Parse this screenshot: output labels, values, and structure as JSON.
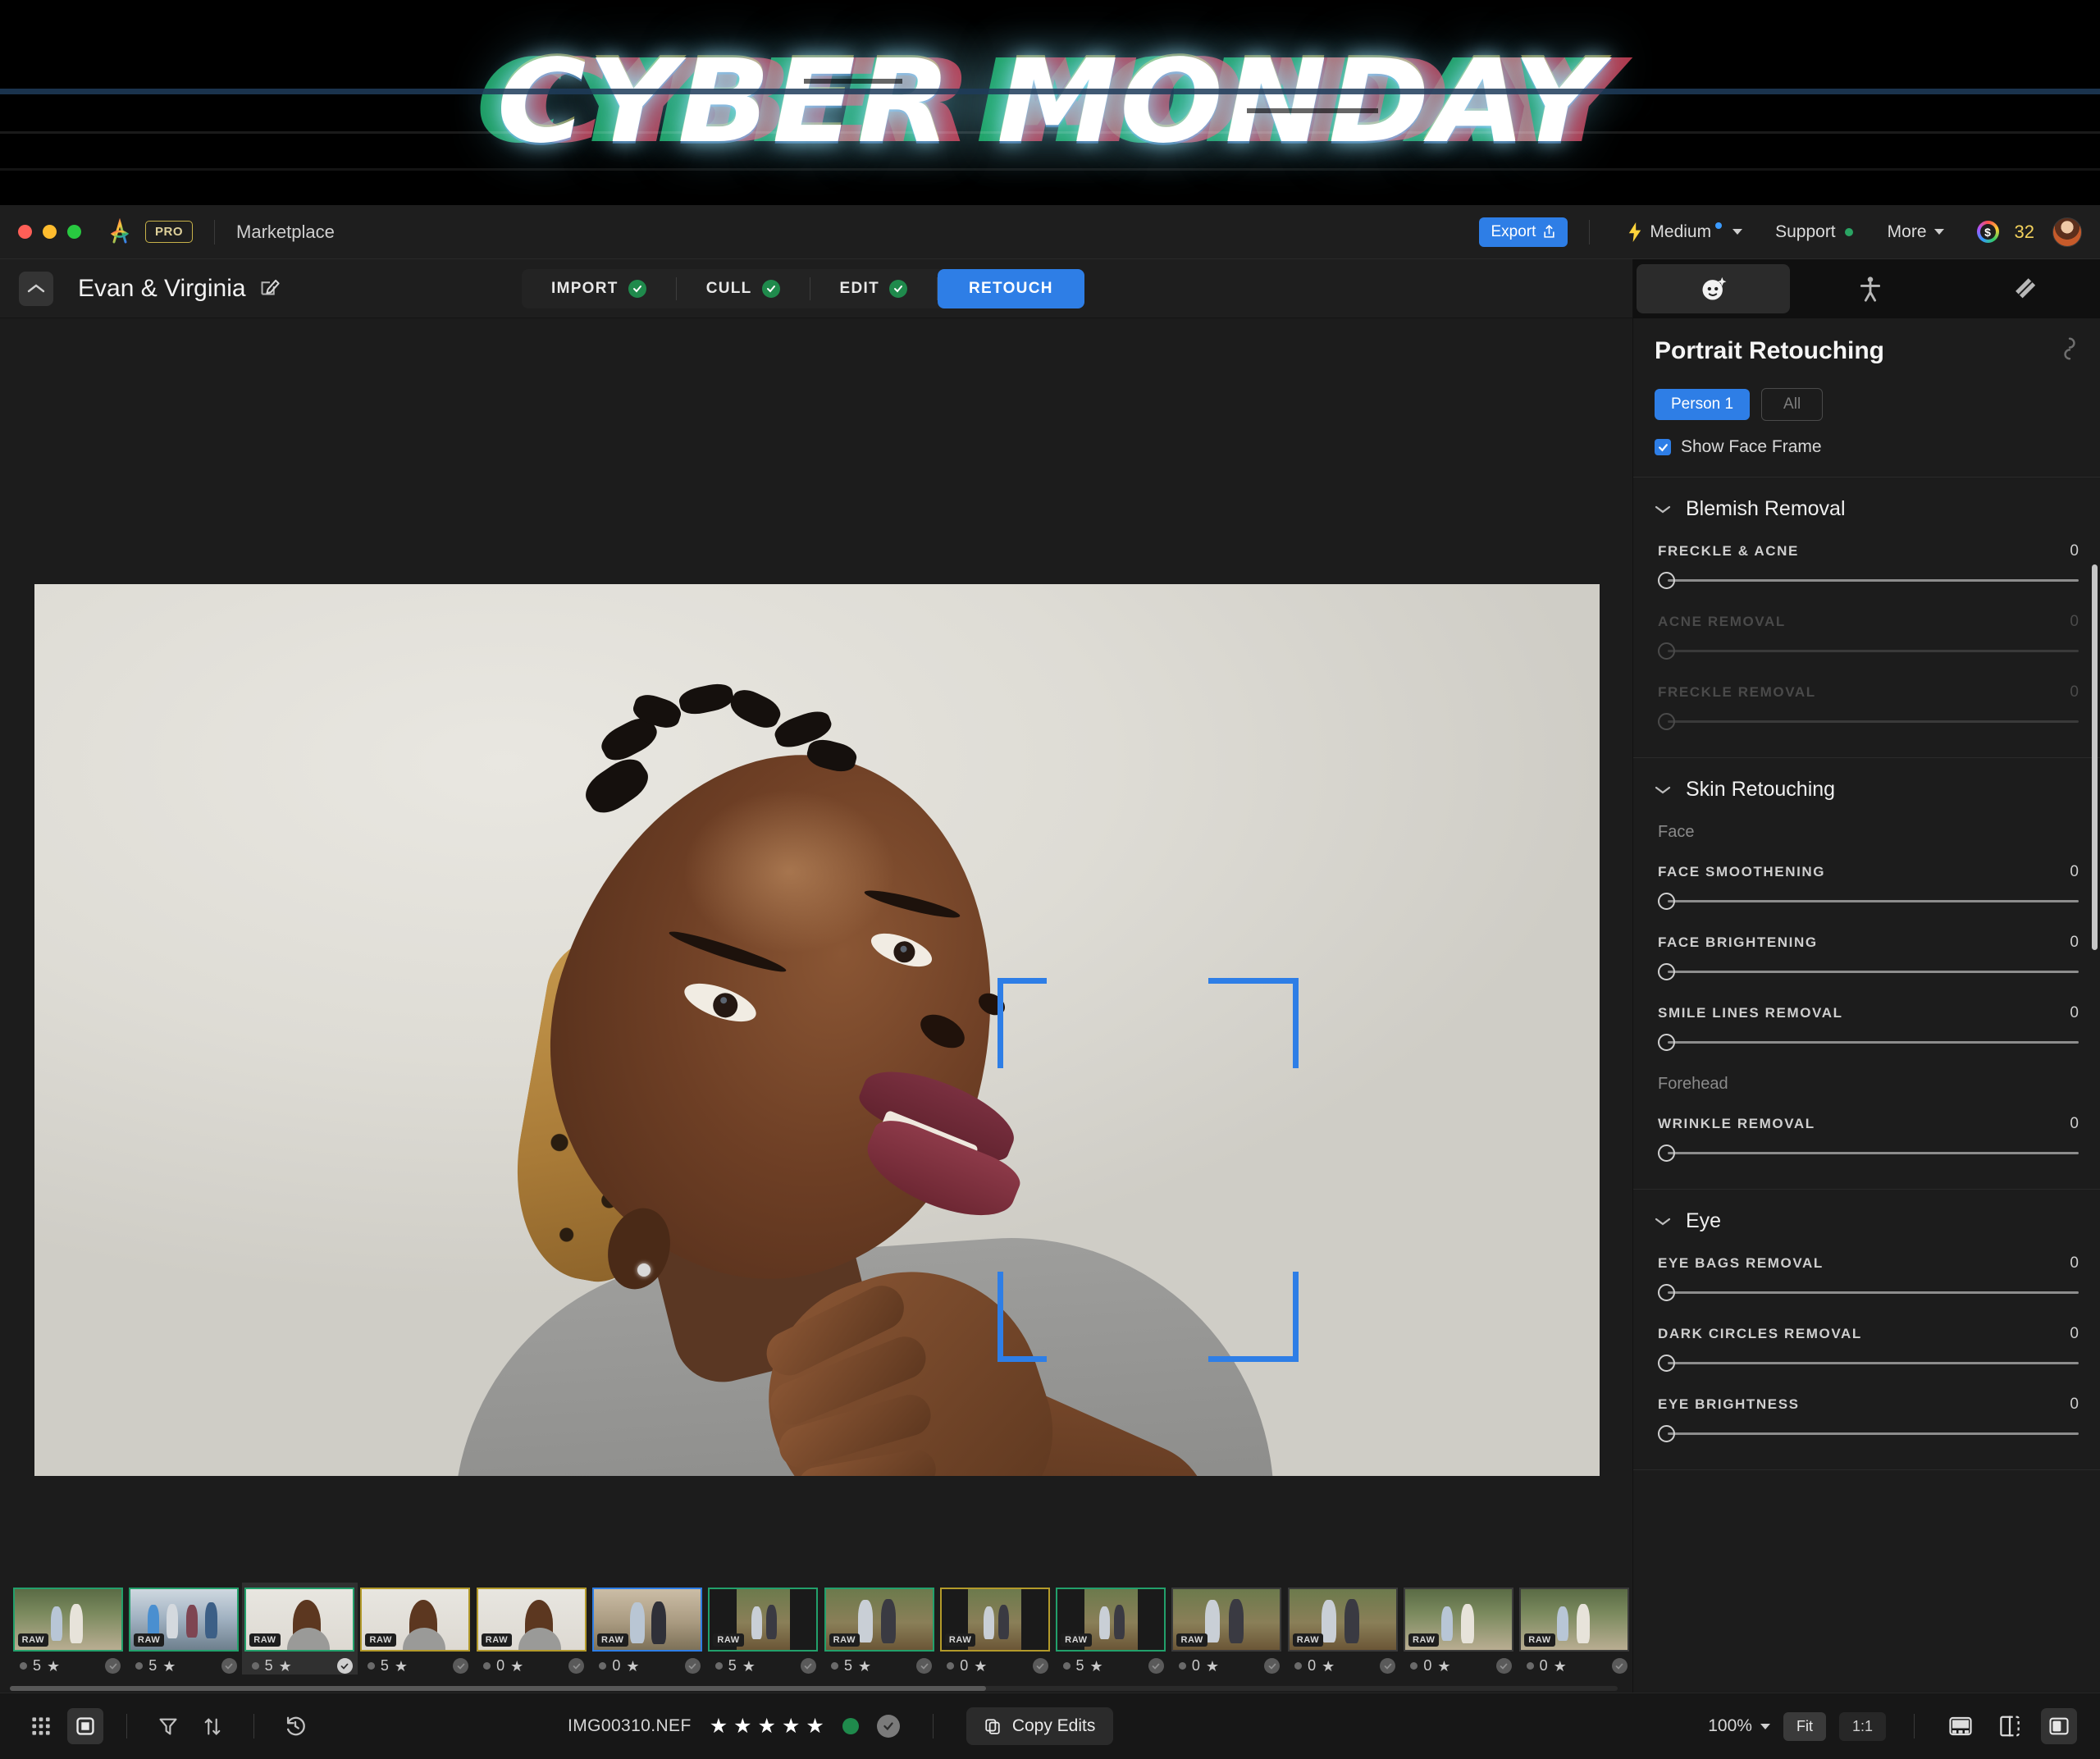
{
  "promo": {
    "text": "CYBER MONDAY"
  },
  "titlebar": {
    "brand_icon": "aftershoot-logo-icon",
    "pro_badge": "PRO",
    "marketplace_label": "Marketplace",
    "export_label": "Export",
    "export_icon": "share-icon",
    "performance_icon": "lightning-icon",
    "performance_label": "Medium",
    "support_label": "Support",
    "more_label": "More",
    "credits_value": "32",
    "credits_icon": "coin-icon",
    "avatar_icon": "user-avatar"
  },
  "toolbar": {
    "collapse_icon": "chevron-up-icon",
    "project_title": "Evan & Virginia",
    "edit_icon": "edit-pencil-icon",
    "tabs": [
      {
        "label": "IMPORT",
        "done": true,
        "active": false
      },
      {
        "label": "CULL",
        "done": true,
        "active": false
      },
      {
        "label": "EDIT",
        "done": true,
        "active": false
      },
      {
        "label": "RETOUCH",
        "done": false,
        "active": true
      }
    ]
  },
  "viewer": {
    "face_frame_visible": true,
    "face_frame_color": "#2e7ee6"
  },
  "filmstrip": {
    "items": [
      {
        "scene": "park",
        "rating": "5",
        "raw": "RAW",
        "border": "green",
        "checked": false,
        "active": false
      },
      {
        "scene": "group",
        "rating": "5",
        "raw": "RAW",
        "border": "green",
        "checked": false,
        "active": false
      },
      {
        "scene": "portrait",
        "rating": "5",
        "raw": "RAW",
        "border": "green",
        "checked": true,
        "active": true
      },
      {
        "scene": "portrait",
        "rating": "5",
        "raw": "RAW",
        "border": "yellow",
        "checked": false,
        "active": false
      },
      {
        "scene": "portrait",
        "rating": "0",
        "raw": "RAW",
        "border": "yellow",
        "checked": false,
        "active": false
      },
      {
        "scene": "steps",
        "rating": "0",
        "raw": "RAW",
        "border": "blue",
        "checked": false,
        "active": false
      },
      {
        "scene": "letter",
        "rating": "5",
        "raw": "RAW",
        "border": "green",
        "checked": false,
        "active": false
      },
      {
        "scene": "bench",
        "rating": "5",
        "raw": "RAW",
        "border": "green",
        "checked": false,
        "active": false
      },
      {
        "scene": "letter",
        "rating": "0",
        "raw": "RAW",
        "border": "yellow",
        "checked": false,
        "active": false
      },
      {
        "scene": "letter",
        "rating": "5",
        "raw": "RAW",
        "border": "green",
        "checked": false,
        "active": false
      },
      {
        "scene": "bench",
        "rating": "0",
        "raw": "RAW",
        "border": "gray",
        "checked": false,
        "active": false
      },
      {
        "scene": "bench",
        "rating": "0",
        "raw": "RAW",
        "border": "gray",
        "checked": false,
        "active": false
      },
      {
        "scene": "park",
        "rating": "0",
        "raw": "RAW",
        "border": "gray",
        "checked": false,
        "active": false
      },
      {
        "scene": "park",
        "rating": "0",
        "raw": "RAW",
        "border": "gray",
        "checked": false,
        "active": false
      }
    ]
  },
  "statusbar": {
    "grid_icon": "grid-view-icon",
    "single_icon": "single-view-icon",
    "filter_icon": "filter-icon",
    "sort_icon": "sort-icon",
    "history_icon": "history-icon",
    "filename": "IMG00310.NEF",
    "rating_stars": 5,
    "color_label_icon": "green-label-dot",
    "approved_icon": "check-circle-icon",
    "copy_edits_label": "Copy Edits",
    "copy_edits_icon": "copy-icon",
    "zoom_level": "100%",
    "zoom_chevron_icon": "chevron-down-icon",
    "fit_label": "Fit",
    "oneone_label": "1:1",
    "filmstrip_toggle_icon": "filmstrip-toggle-icon",
    "compare_icon": "before-after-icon",
    "panel_toggle_icon": "right-panel-toggle-icon"
  },
  "panel": {
    "tabs": [
      {
        "icon": "face-retouch-icon",
        "active": true
      },
      {
        "icon": "body-retouch-icon",
        "active": false
      },
      {
        "icon": "eraser-icon",
        "active": false
      }
    ],
    "title": "Portrait Retouching",
    "link_icon": "link-chain-icon",
    "person_chips": [
      {
        "label": "Person 1",
        "active": true
      },
      {
        "label": "All",
        "active": false
      }
    ],
    "show_face_frame_label": "Show Face Frame",
    "show_face_frame_checked": true,
    "sections": [
      {
        "title": "Blemish Removal",
        "expanded": true,
        "groups": [
          {
            "label": null,
            "sliders": [
              {
                "name": "FRECKLE & ACNE",
                "value": "0",
                "percent": 0,
                "disabled": false
              },
              {
                "name": "ACNE REMOVAL",
                "value": "0",
                "percent": 0,
                "disabled": true
              },
              {
                "name": "FRECKLE REMOVAL",
                "value": "0",
                "percent": 0,
                "disabled": true
              }
            ]
          }
        ]
      },
      {
        "title": "Skin Retouching",
        "expanded": true,
        "groups": [
          {
            "label": "Face",
            "sliders": [
              {
                "name": "FACE SMOOTHENING",
                "value": "0",
                "percent": 0,
                "disabled": false
              },
              {
                "name": "FACE BRIGHTENING",
                "value": "0",
                "percent": 0,
                "disabled": false
              },
              {
                "name": "SMILE LINES REMOVAL",
                "value": "0",
                "percent": 0,
                "disabled": false
              }
            ]
          },
          {
            "label": "Forehead",
            "sliders": [
              {
                "name": "WRINKLE REMOVAL",
                "value": "0",
                "percent": 0,
                "disabled": false
              }
            ]
          }
        ]
      },
      {
        "title": "Eye",
        "expanded": true,
        "groups": [
          {
            "label": null,
            "sliders": [
              {
                "name": "EYE BAGS REMOVAL",
                "value": "0",
                "percent": 0,
                "disabled": false
              },
              {
                "name": "DARK CIRCLES REMOVAL",
                "value": "0",
                "percent": 0,
                "disabled": false
              },
              {
                "name": "EYE BRIGHTNESS",
                "value": "0",
                "percent": 0,
                "disabled": false
              }
            ]
          }
        ]
      }
    ]
  },
  "colors": {
    "accent": "#2e7ee6",
    "done_green": "#1f8a4c",
    "credit_yellow": "#f3d15c",
    "panel_bg": "#1c1c1c"
  }
}
